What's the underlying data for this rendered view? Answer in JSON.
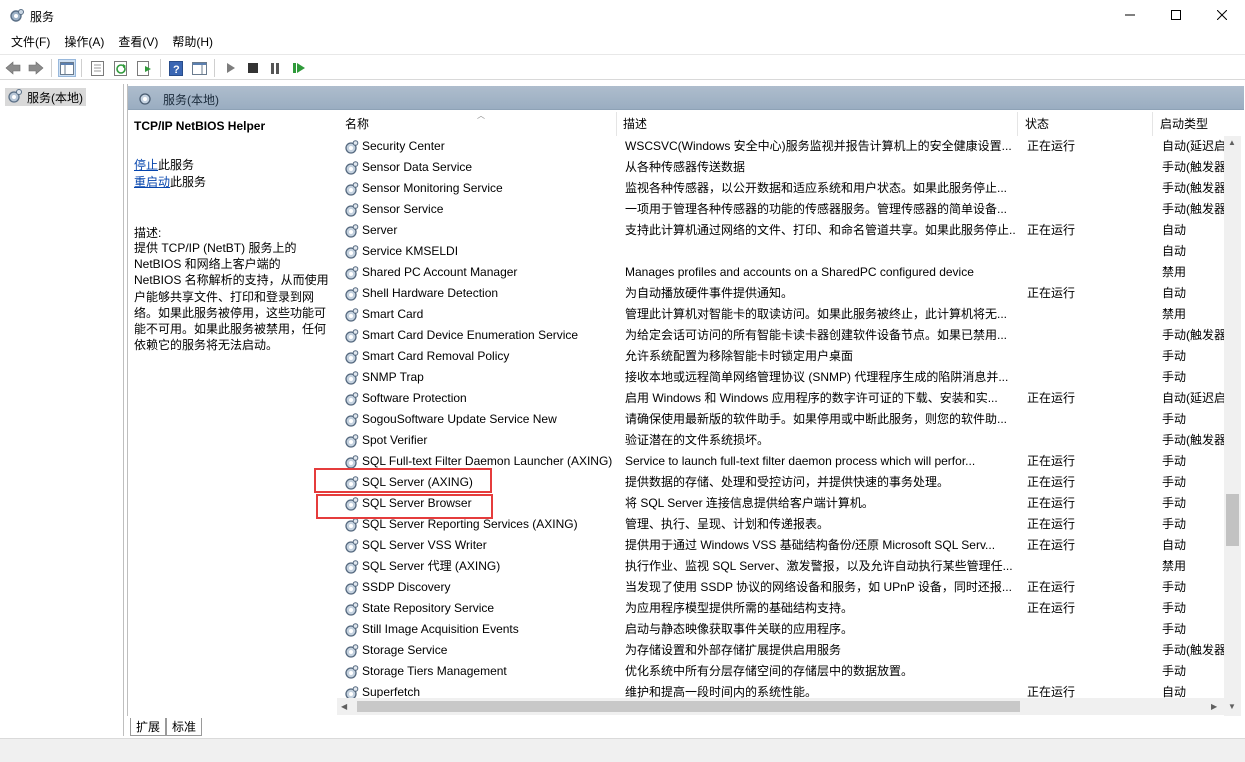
{
  "window": {
    "title": "服务"
  },
  "menu": [
    "文件(F)",
    "操作(A)",
    "查看(V)",
    "帮助(H)"
  ],
  "tree": {
    "root_label": "服务(本地)"
  },
  "pane_header": {
    "title": "服务(本地)"
  },
  "detail": {
    "service_name": "TCP/IP NetBIOS Helper",
    "stop_link": "停止",
    "stop_suffix": "此服务",
    "restart_link": "重启动",
    "restart_suffix": "此服务",
    "desc_label": "描述:",
    "desc_lines": [
      "提供 TCP/IP (NetBT) 服务上的",
      "NetBIOS 和网络上客户端的",
      "NetBIOS 名称解析的支持，从而使用",
      "户能够共享文件、打印和登录到网",
      "络。如果此服务被停用，这些功能可",
      "能不可用。如果此服务被禁用，任何",
      "依赖它的服务将无法启动。"
    ]
  },
  "columns": {
    "name": "名称",
    "desc": "描述",
    "status": "状态",
    "start": "启动类型"
  },
  "rows": [
    {
      "name": "Security Center",
      "desc": "WSCSVC(Windows 安全中心)服务监视并报告计算机上的安全健康设置...",
      "status": "正在运行",
      "start": "自动(延迟启"
    },
    {
      "name": "Sensor Data Service",
      "desc": "从各种传感器传送数据",
      "status": "",
      "start": "手动(触发器"
    },
    {
      "name": "Sensor Monitoring Service",
      "desc": "监视各种传感器，以公开数据和适应系统和用户状态。如果此服务停止...",
      "status": "",
      "start": "手动(触发器"
    },
    {
      "name": "Sensor Service",
      "desc": "一项用于管理各种传感器的功能的传感器服务。管理传感器的简单设备...",
      "status": "",
      "start": "手动(触发器"
    },
    {
      "name": "Server",
      "desc": "支持此计算机通过网络的文件、打印、和命名管道共享。如果此服务停止...",
      "status": "正在运行",
      "start": "自动"
    },
    {
      "name": "Service KMSELDI",
      "desc": "",
      "status": "",
      "start": "自动"
    },
    {
      "name": "Shared PC Account Manager",
      "desc": "Manages profiles and accounts on a SharedPC configured device",
      "status": "",
      "start": "禁用"
    },
    {
      "name": "Shell Hardware Detection",
      "desc": "为自动播放硬件事件提供通知。",
      "status": "正在运行",
      "start": "自动"
    },
    {
      "name": "Smart Card",
      "desc": "管理此计算机对智能卡的取读访问。如果此服务被终止，此计算机将无...",
      "status": "",
      "start": "禁用"
    },
    {
      "name": "Smart Card Device Enumeration Service",
      "desc": "为给定会话可访问的所有智能卡读卡器创建软件设备节点。如果已禁用...",
      "status": "",
      "start": "手动(触发器"
    },
    {
      "name": "Smart Card Removal Policy",
      "desc": "允许系统配置为移除智能卡时锁定用户桌面",
      "status": "",
      "start": "手动"
    },
    {
      "name": "SNMP Trap",
      "desc": "接收本地或远程简单网络管理协议 (SNMP) 代理程序生成的陷阱消息并...",
      "status": "",
      "start": "手动"
    },
    {
      "name": "Software Protection",
      "desc": "启用 Windows 和 Windows 应用程序的数字许可证的下载、安装和实...",
      "status": "正在运行",
      "start": "自动(延迟启"
    },
    {
      "name": "SogouSoftware Update Service New",
      "desc": "请确保使用最新版的软件助手。如果停用或中断此服务，则您的软件助...",
      "status": "",
      "start": "手动"
    },
    {
      "name": "Spot Verifier",
      "desc": "验证潜在的文件系统损坏。",
      "status": "",
      "start": "手动(触发器"
    },
    {
      "name": "SQL Full-text Filter Daemon Launcher (AXING)",
      "desc": "Service to launch full-text filter daemon process which will perfor...",
      "status": "正在运行",
      "start": "手动"
    },
    {
      "name": "SQL Server (AXING)",
      "desc": "提供数据的存储、处理和受控访问，并提供快速的事务处理。",
      "status": "正在运行",
      "start": "手动"
    },
    {
      "name": "SQL Server Browser",
      "desc": "将 SQL Server 连接信息提供给客户端计算机。",
      "status": "正在运行",
      "start": "手动"
    },
    {
      "name": "SQL Server Reporting Services (AXING)",
      "desc": "管理、执行、呈现、计划和传递报表。",
      "status": "正在运行",
      "start": "手动"
    },
    {
      "name": "SQL Server VSS Writer",
      "desc": "提供用于通过 Windows VSS 基础结构备份/还原 Microsoft SQL Serv...",
      "status": "正在运行",
      "start": "自动"
    },
    {
      "name": "SQL Server 代理 (AXING)",
      "desc": "执行作业、监视 SQL Server、激发警报，以及允许自动执行某些管理任...",
      "status": "",
      "start": "禁用"
    },
    {
      "name": "SSDP Discovery",
      "desc": "当发现了使用 SSDP 协议的网络设备和服务，如 UPnP 设备，同时还报...",
      "status": "正在运行",
      "start": "手动"
    },
    {
      "name": "State Repository Service",
      "desc": "为应用程序模型提供所需的基础结构支持。",
      "status": "正在运行",
      "start": "手动"
    },
    {
      "name": "Still Image Acquisition Events",
      "desc": "启动与静态映像获取事件关联的应用程序。",
      "status": "",
      "start": "手动"
    },
    {
      "name": "Storage Service",
      "desc": "为存储设置和外部存储扩展提供启用服务",
      "status": "",
      "start": "手动(触发器"
    },
    {
      "name": "Storage Tiers Management",
      "desc": "优化系统中所有分层存储空间的存储层中的数据放置。",
      "status": "",
      "start": "手动"
    },
    {
      "name": "Superfetch",
      "desc": "维护和提高一段时间内的系统性能。",
      "status": "正在运行",
      "start": "自动"
    }
  ],
  "tabs": [
    "扩展",
    "标准"
  ],
  "colors": {
    "highlight_box": "#e53c3c",
    "pane_header": "#a4b5c8",
    "link": "#0645ad"
  }
}
